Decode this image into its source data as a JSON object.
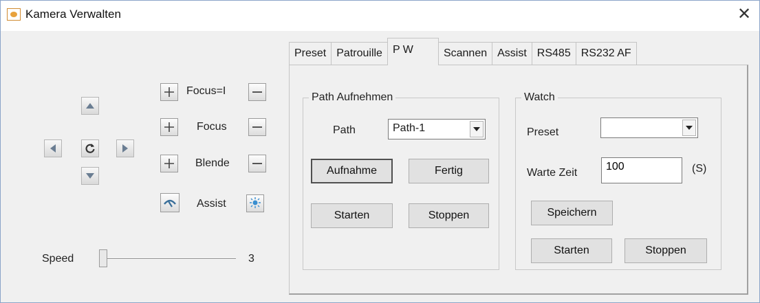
{
  "window": {
    "title": "Kamera Verwalten",
    "close_glyph": "✕"
  },
  "controls": {
    "rows": [
      {
        "label": "Focus=I",
        "plus": "+",
        "minus": "—"
      },
      {
        "label": "Focus",
        "plus": "+",
        "minus": "—"
      },
      {
        "label": "Blende",
        "plus": "+",
        "minus": "—"
      }
    ],
    "assist_label": "Assist",
    "icons": {
      "pan_up": "arrow-up-icon",
      "pan_down": "arrow-down-icon",
      "pan_left": "arrow-left-icon",
      "pan_right": "arrow-right-icon",
      "home": "refresh-icon",
      "wiper": "wiper-icon",
      "light": "light-icon"
    },
    "speed_label": "Speed",
    "speed_value": "3",
    "speed_fraction": 0.0
  },
  "tabs": [
    {
      "label": "Preset",
      "active": false
    },
    {
      "label": "Patrouille",
      "active": false
    },
    {
      "label": "P W",
      "active": true
    },
    {
      "label": "Scannen",
      "active": false
    },
    {
      "label": "Assist",
      "active": false
    },
    {
      "label": "RS485",
      "active": false
    },
    {
      "label": "RS232 AF",
      "active": false
    }
  ],
  "path_group": {
    "legend": "Path Aufnehmen",
    "path_label": "Path",
    "path_value": "Path-1",
    "record_button": "Aufnahme",
    "done_button": "Fertig",
    "start_button": "Starten",
    "stop_button": "Stoppen"
  },
  "watch_group": {
    "legend": "Watch",
    "preset_label": "Preset",
    "preset_value": "",
    "wait_label": "Warte Zeit",
    "wait_value": "100",
    "unit": "(S)",
    "save_button": "Speichern",
    "start_button": "Starten",
    "stop_button": "Stoppen"
  },
  "colors": {
    "accent_icon": "#3a8fd0",
    "window_border": "#8aa4c8"
  }
}
